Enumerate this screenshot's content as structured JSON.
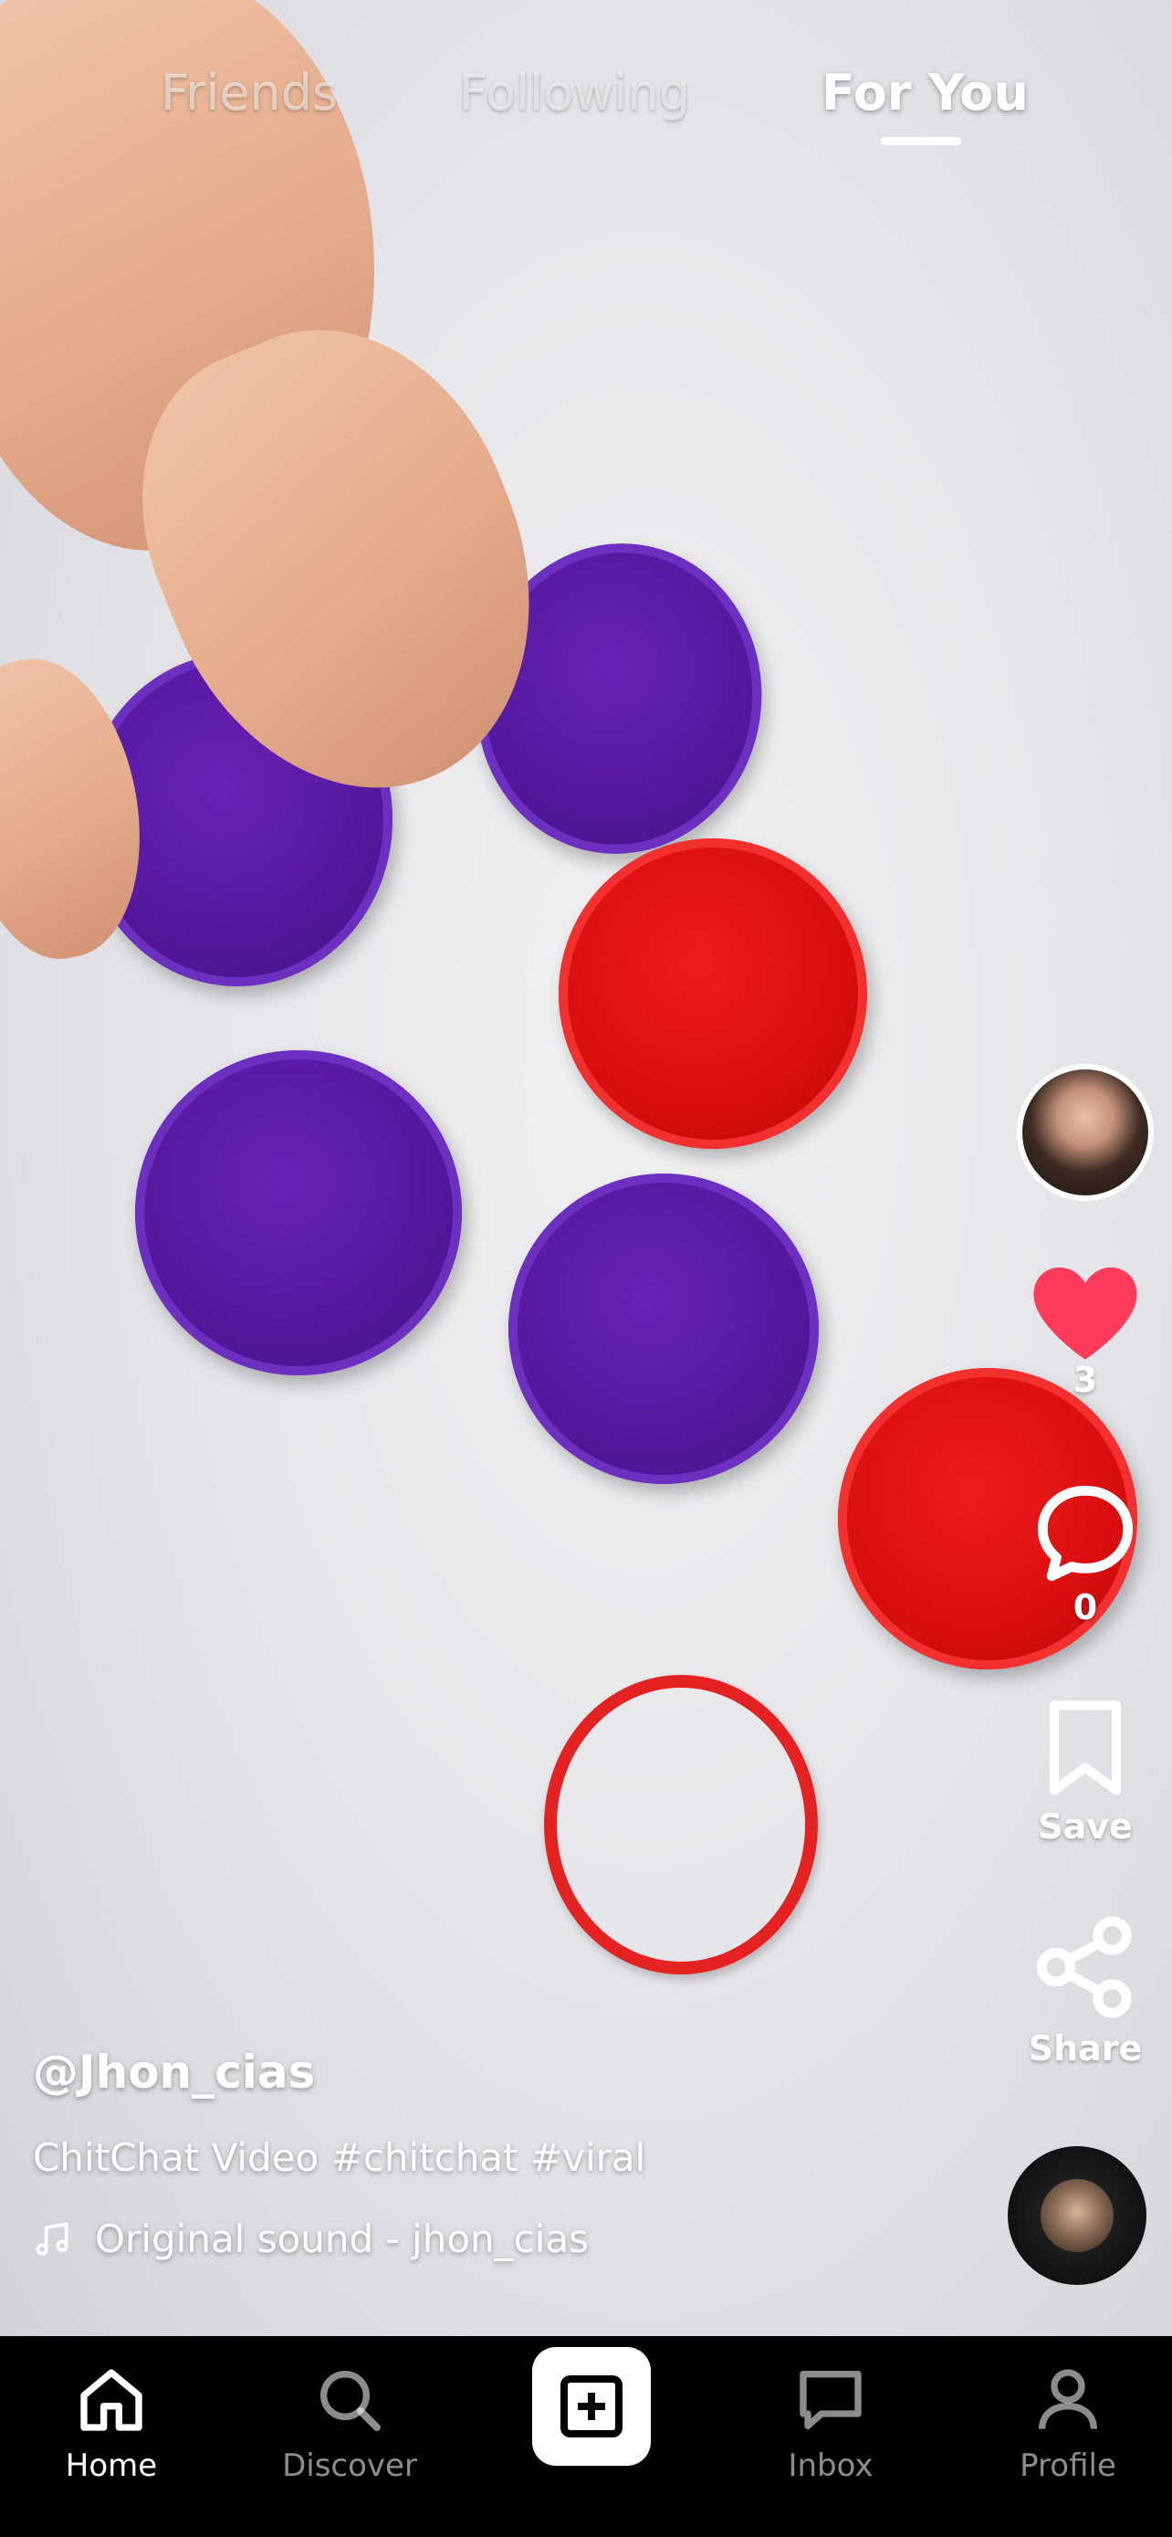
{
  "top_tabs": {
    "friends": "Friends",
    "following": "Following",
    "for_you": "For You"
  },
  "actions": {
    "like_count": "3",
    "comment_count": "0",
    "save_label": "Save",
    "share_label": "Share"
  },
  "post": {
    "username": "@Jhon_cias",
    "description": "ChitChat Video #chitchat #viral",
    "sound": "Original sound - jhon_cias"
  },
  "bottom_nav": {
    "home": "Home",
    "discover": "Discover",
    "inbox": "Inbox",
    "profile": "Profile"
  },
  "colors": {
    "like": "#ff3b5c",
    "nav_background": "#000000"
  },
  "icons": [
    "heart-icon",
    "comment-icon",
    "bookmark-icon",
    "share-icon",
    "music-note-icon",
    "home-icon",
    "search-icon",
    "plus-icon",
    "inbox-icon",
    "profile-icon"
  ]
}
